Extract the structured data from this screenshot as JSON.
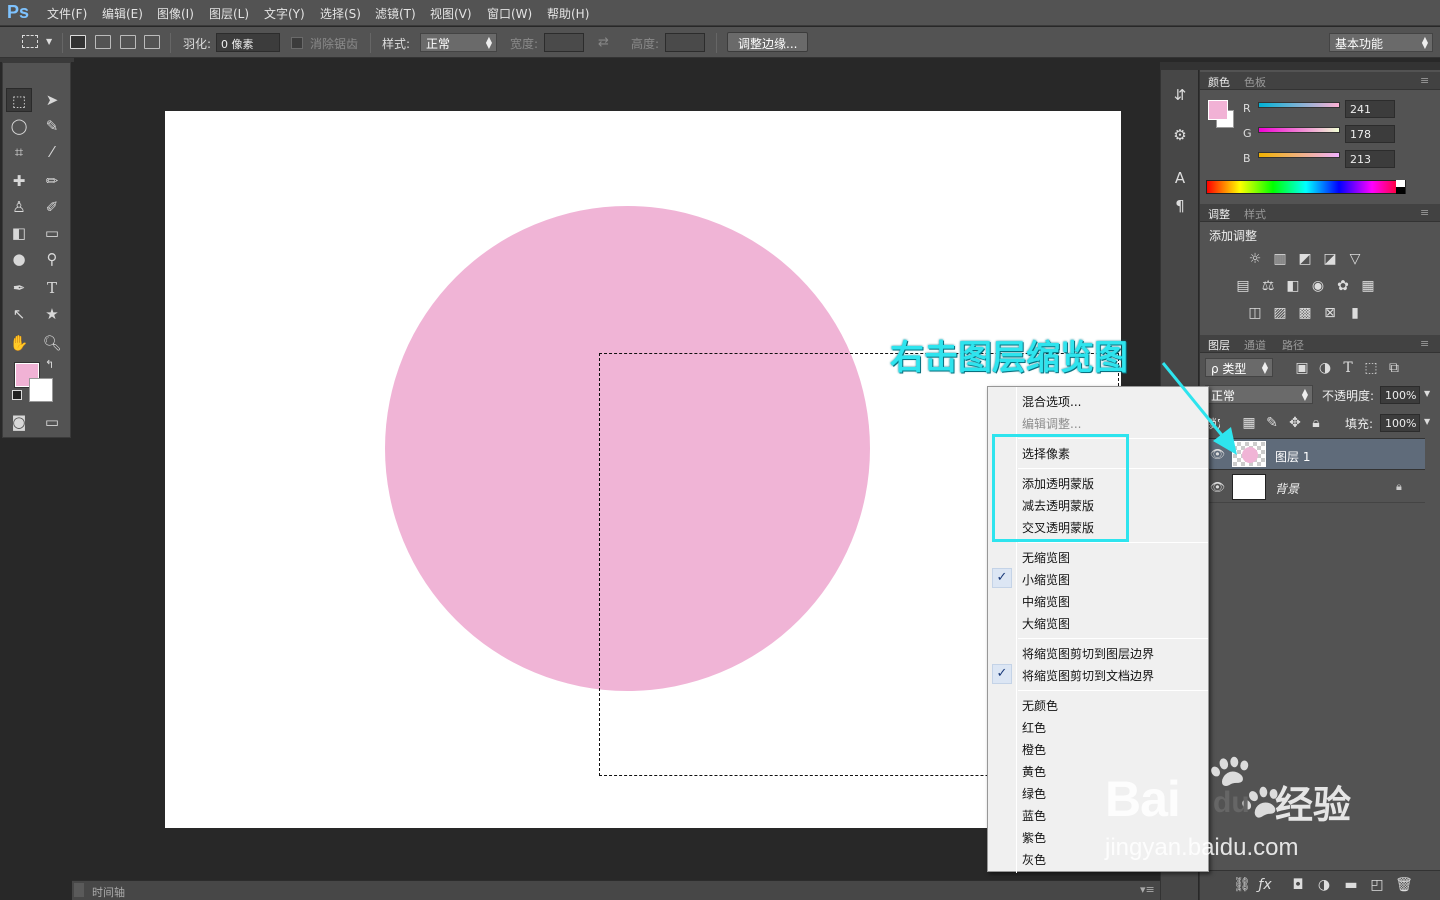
{
  "app": {
    "logo": "Ps"
  },
  "menubar": [
    "文件(F)",
    "编辑(E)",
    "图像(I)",
    "图层(L)",
    "文字(Y)",
    "选择(S)",
    "滤镜(T)",
    "视图(V)",
    "窗口(W)",
    "帮助(H)"
  ],
  "options": {
    "feather_label": "羽化:",
    "feather_value": "0 像素",
    "antialias_label": "消除锯齿",
    "style_label": "样式:",
    "style_value": "正常",
    "width_label": "宽度:",
    "height_label": "高度:",
    "refine_edge": "调整边缘...",
    "workspace": "基本功能"
  },
  "colors": {
    "foreground": "#f1b2d5",
    "background": "#ffffff",
    "accent": "#2ee4ee",
    "circle": "#f0b4d6"
  },
  "color_panel": {
    "tabs": [
      "颜色",
      "色板"
    ],
    "r_label": "R",
    "r_value": "241",
    "g_label": "G",
    "g_value": "178",
    "b_label": "B",
    "b_value": "213"
  },
  "adjust_panel": {
    "tabs": [
      "调整",
      "样式"
    ],
    "title": "添加调整"
  },
  "layers_panel": {
    "tabs": [
      "图层",
      "通道",
      "路径"
    ],
    "filter": "ρ 类型",
    "blend_mode": "正常",
    "opacity_label": "不透明度:",
    "opacity_value": "100%",
    "lock_label": "锁定:",
    "fill_label": "填充:",
    "fill_value": "100%",
    "layers": [
      {
        "name": "图层 1",
        "selected": true
      },
      {
        "name": "背景",
        "locked": true
      }
    ]
  },
  "context_menu": {
    "items": [
      {
        "label": "混合选项...",
        "enabled": true
      },
      {
        "label": "编辑调整...",
        "enabled": false
      },
      {
        "label": "选择像素",
        "enabled": true
      },
      {
        "label": "添加透明蒙版",
        "enabled": true
      },
      {
        "label": "减去透明蒙版",
        "enabled": true
      },
      {
        "label": "交叉透明蒙版",
        "enabled": true
      },
      {
        "label": "无缩览图",
        "enabled": true
      },
      {
        "label": "小缩览图",
        "enabled": true,
        "checked": true
      },
      {
        "label": "中缩览图",
        "enabled": true
      },
      {
        "label": "大缩览图",
        "enabled": true
      },
      {
        "label": "将缩览图剪切到图层边界",
        "enabled": true
      },
      {
        "label": "将缩览图剪切到文档边界",
        "enabled": true,
        "checked": true
      },
      {
        "label": "无颜色",
        "enabled": true
      },
      {
        "label": "红色",
        "enabled": true
      },
      {
        "label": "橙色",
        "enabled": true
      },
      {
        "label": "黄色",
        "enabled": true
      },
      {
        "label": "绿色",
        "enabled": true
      },
      {
        "label": "蓝色",
        "enabled": true
      },
      {
        "label": "紫色",
        "enabled": true
      },
      {
        "label": "灰色",
        "enabled": true
      }
    ]
  },
  "annotation": {
    "callout": "右击图层缩览图"
  },
  "timeline": {
    "label": "时间轴"
  },
  "watermark": {
    "brand": "Bai",
    "brand2": "du",
    "suffix": "经验",
    "url": "jingyan.baidu.com"
  }
}
